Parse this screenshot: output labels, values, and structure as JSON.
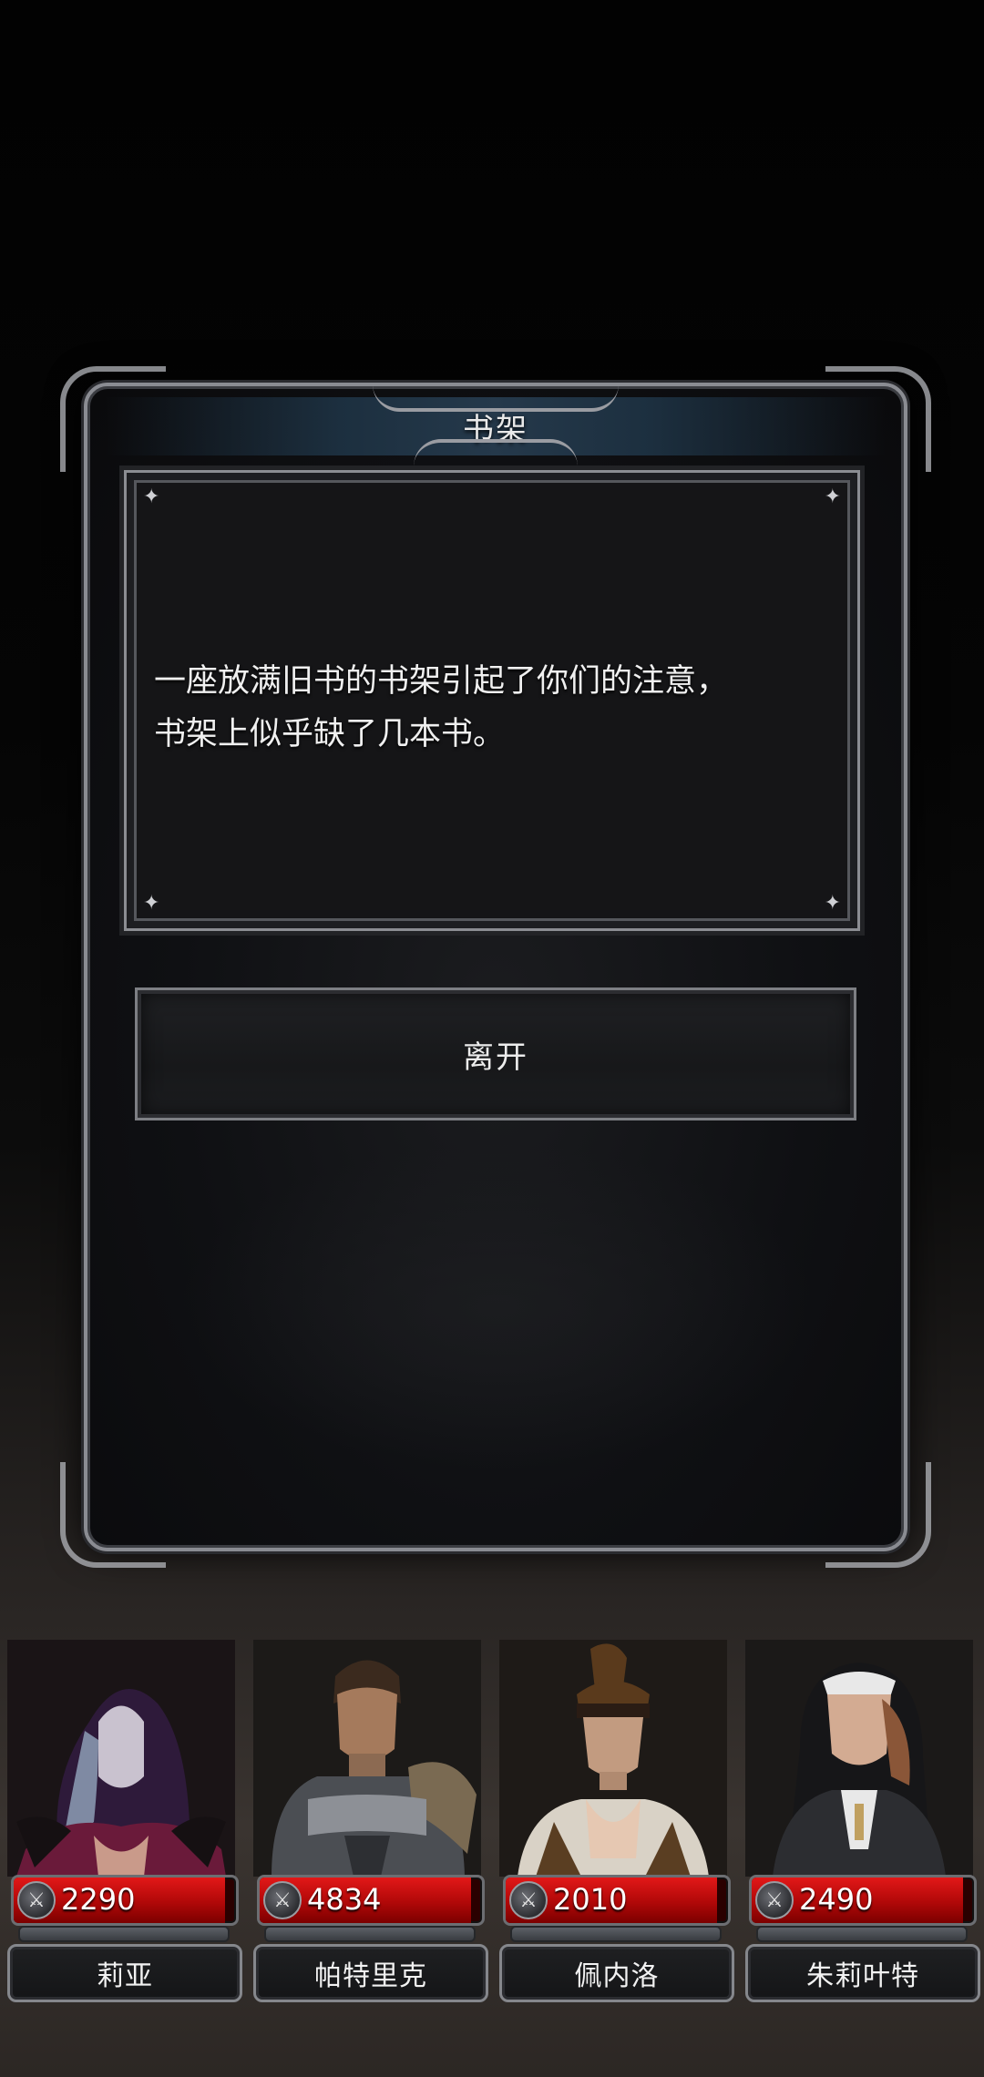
{
  "dialog": {
    "title": "书架",
    "text_lines": [
      "一座放满旧书的书架引起了你们的注意，",
      "书架上似乎缺了几本书。"
    ],
    "leave_label": "离开"
  },
  "party": [
    {
      "name": "莉亚",
      "hp": "2290",
      "hp_fraction": 0.95,
      "portrait": "hooded-sorceress"
    },
    {
      "name": "帕特里克",
      "hp": "4834",
      "hp_fraction": 0.95,
      "portrait": "armored-knight"
    },
    {
      "name": "佩内洛",
      "hp": "2010",
      "hp_fraction": 0.95,
      "portrait": "ponytail-fighter"
    },
    {
      "name": "朱莉叶特",
      "hp": "2490",
      "hp_fraction": 0.95,
      "portrait": "nun-priestess"
    }
  ],
  "colors": {
    "hp_red": "#c40e0e",
    "frame_silver": "#8a8c92",
    "title_blue": "#25394b"
  },
  "icons": {
    "hp_icon": "sword-icon"
  }
}
